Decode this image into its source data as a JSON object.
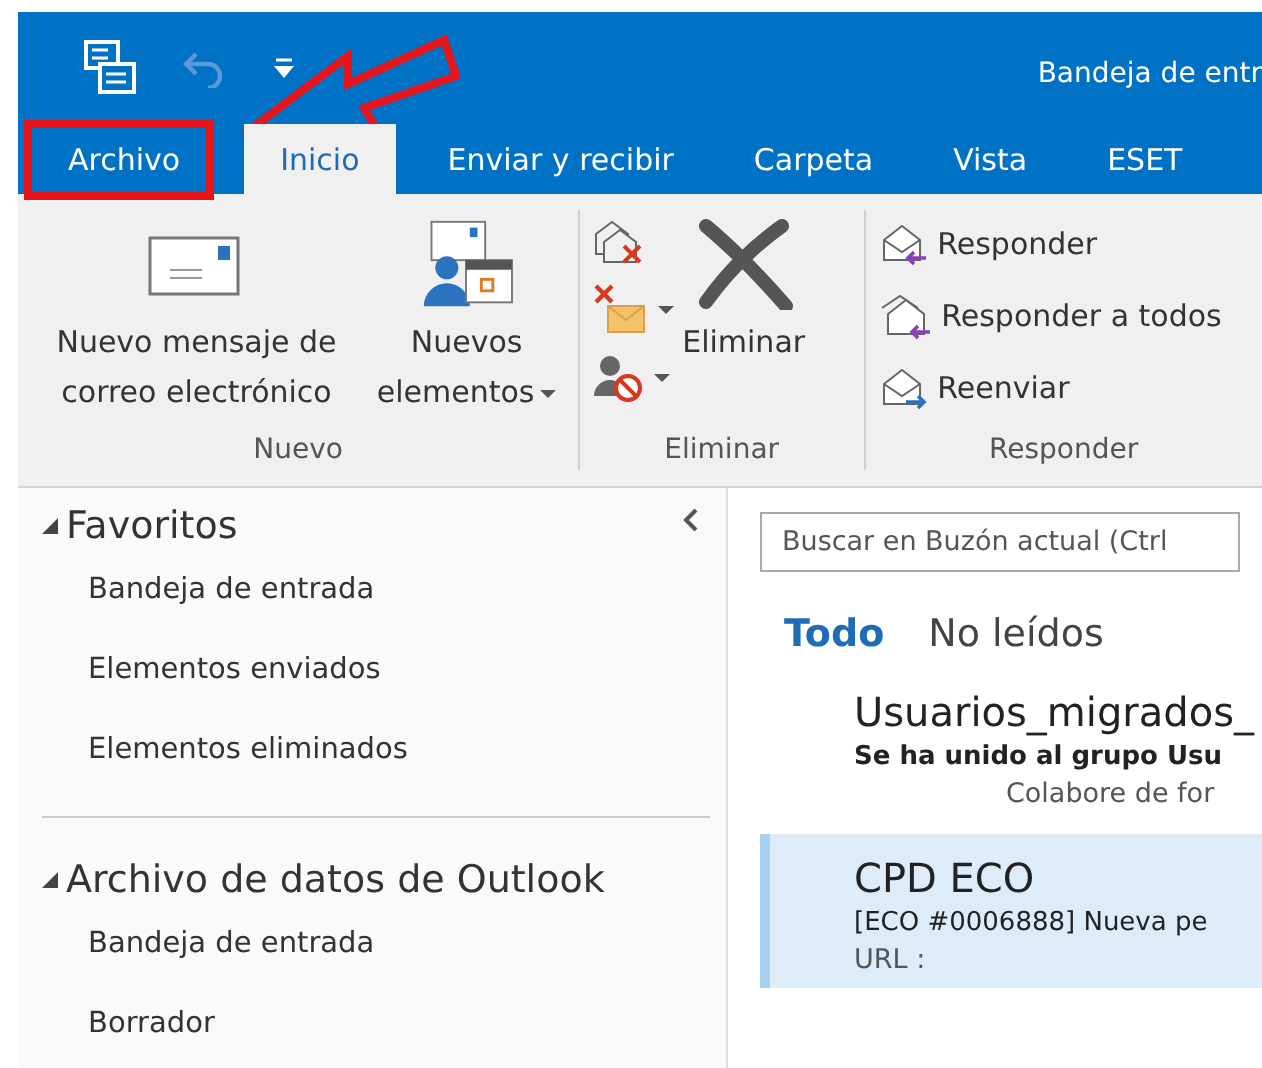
{
  "window": {
    "title": "Bandeja de entr"
  },
  "tabs": [
    {
      "label": "Archivo",
      "selected": false,
      "highlighted": true
    },
    {
      "label": "Inicio",
      "selected": true,
      "highlighted": false
    },
    {
      "label": "Enviar y recibir",
      "selected": false,
      "highlighted": false
    },
    {
      "label": "Carpeta",
      "selected": false,
      "highlighted": false
    },
    {
      "label": "Vista",
      "selected": false,
      "highlighted": false
    },
    {
      "label": "ESET",
      "selected": false,
      "highlighted": false
    }
  ],
  "ribbon": {
    "groups": [
      {
        "label": "Nuevo",
        "items": [
          {
            "kind": "large",
            "label": "Nuevo mensaje de correo electrónico",
            "dropdown": false
          },
          {
            "kind": "large",
            "label": "Nuevos elementos",
            "dropdown": true
          }
        ]
      },
      {
        "label": "Eliminar",
        "items": [
          {
            "kind": "icon",
            "dropdown": false
          },
          {
            "kind": "icon",
            "dropdown": true
          },
          {
            "kind": "icon",
            "dropdown": true
          },
          {
            "kind": "large",
            "label": "Eliminar",
            "dropdown": false
          }
        ]
      },
      {
        "label": "Responder",
        "items": [
          {
            "kind": "small",
            "label": "Responder",
            "dropdown": false
          },
          {
            "kind": "small",
            "label": "Responder a todos",
            "dropdown": false
          },
          {
            "kind": "small",
            "label": "Reenviar",
            "dropdown": false
          }
        ]
      }
    ]
  },
  "navigation": {
    "sections": [
      {
        "title": "Favoritos",
        "expanded": true,
        "items": [
          "Bandeja de entrada",
          "Elementos enviados",
          "Elementos eliminados"
        ]
      },
      {
        "title": "Archivo de datos de Outlook",
        "expanded": true,
        "items": [
          "Bandeja de entrada",
          "Borrador"
        ]
      }
    ]
  },
  "search": {
    "placeholder": "Buscar en Buzón actual (Ctrl"
  },
  "filters": [
    {
      "label": "Todo",
      "selected": true
    },
    {
      "label": "No leídos",
      "selected": false
    }
  ],
  "messages": [
    {
      "sender": "Usuarios_migrados_",
      "subject": "Se ha unido al grupo Usu",
      "preview": "Colabore de for",
      "selected": false
    },
    {
      "sender": "CPD ECO",
      "subject": "[ECO #0006888] Nueva pe",
      "preview": "URL :",
      "selected": true
    }
  ]
}
